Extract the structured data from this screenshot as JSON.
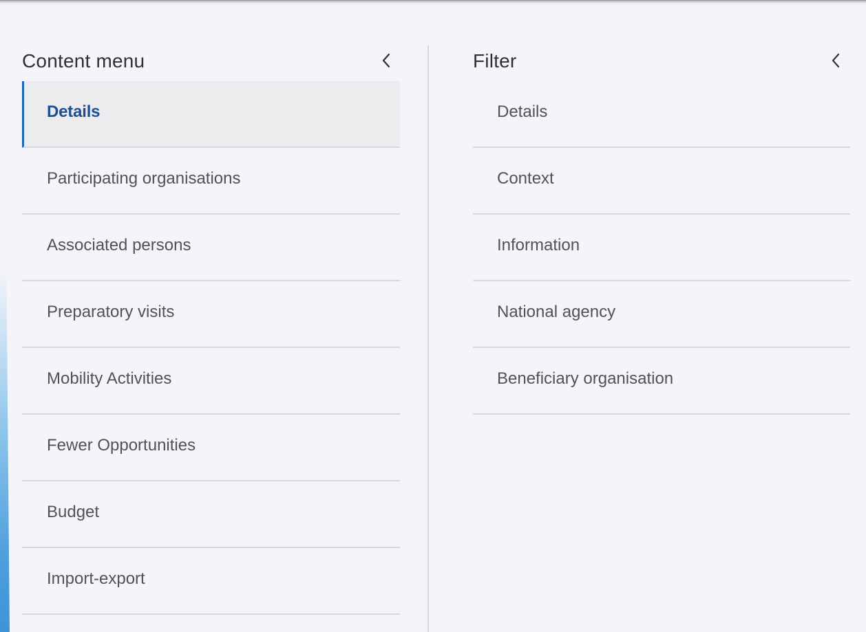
{
  "content_menu": {
    "title": "Content menu",
    "collapse_icon": "chevron-left-icon",
    "items": [
      {
        "label": "Details",
        "active": true
      },
      {
        "label": "Participating organisations"
      },
      {
        "label": "Associated persons"
      },
      {
        "label": "Preparatory visits"
      },
      {
        "label": "Mobility Activities"
      },
      {
        "label": "Fewer Opportunities"
      },
      {
        "label": "Budget"
      },
      {
        "label": "Import-export"
      }
    ]
  },
  "filter": {
    "title": "Filter",
    "collapse_icon": "chevron-left-icon",
    "items": [
      {
        "label": "Details"
      },
      {
        "label": "Context"
      },
      {
        "label": "Information"
      },
      {
        "label": "National agency"
      },
      {
        "label": "Beneficiary organisation"
      }
    ]
  },
  "colors": {
    "accent": "#1a67b3",
    "active_text": "#1c4f94",
    "background": "#f4f5f9",
    "active_background": "#ececee"
  }
}
